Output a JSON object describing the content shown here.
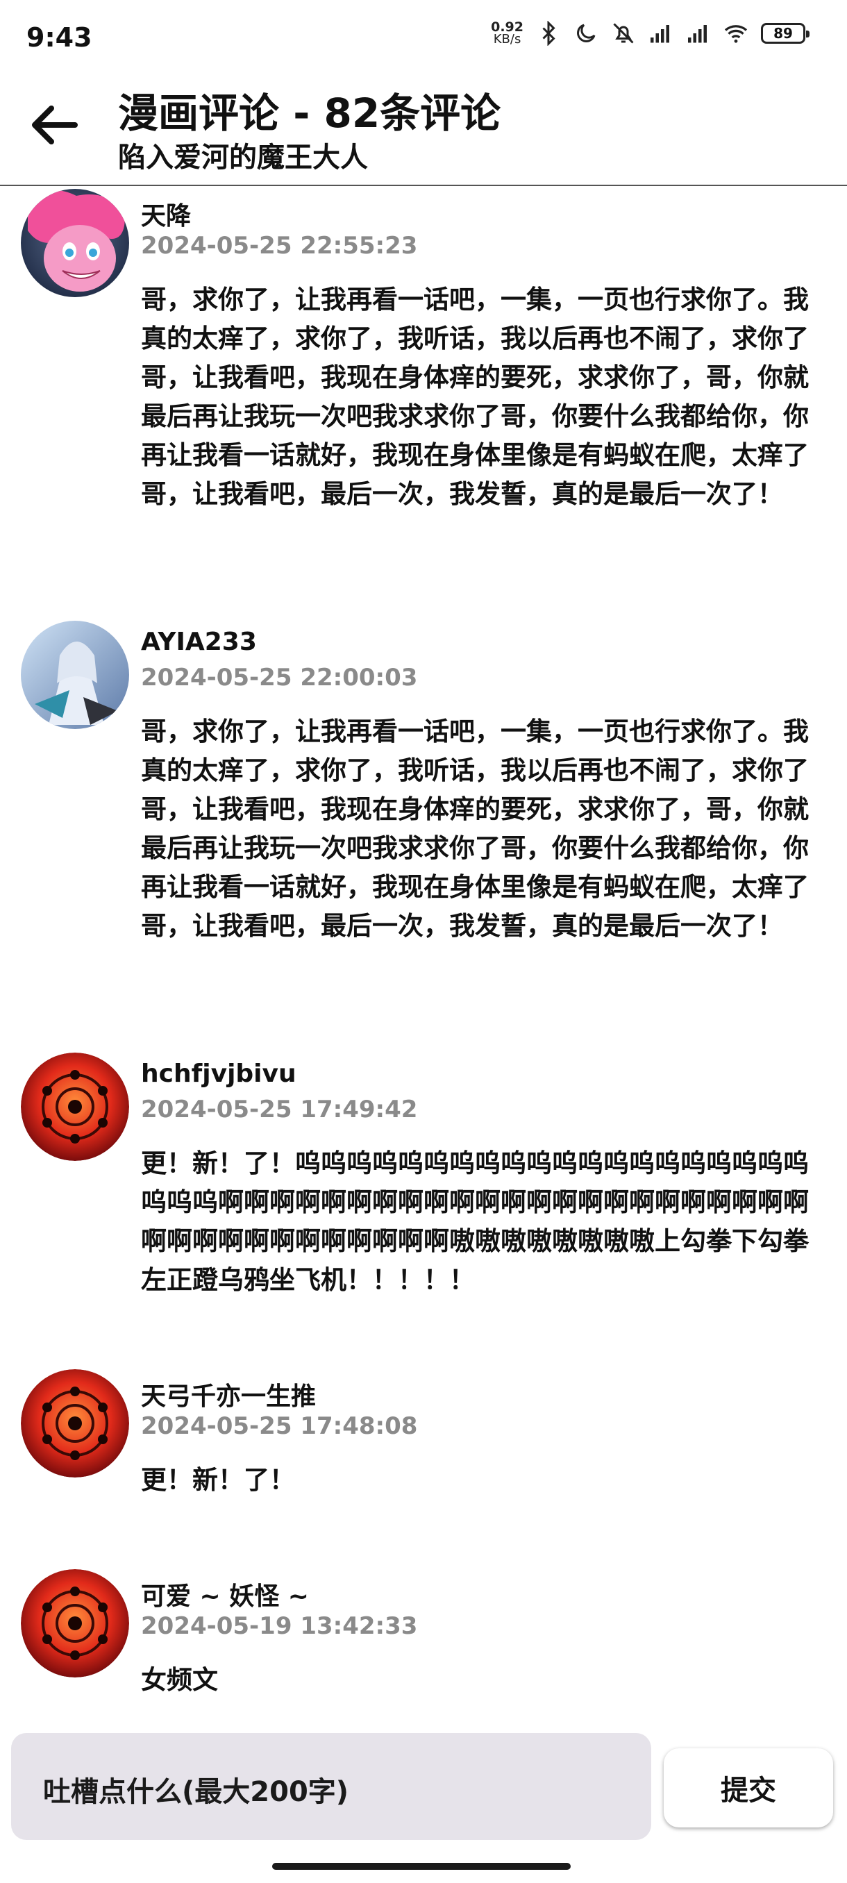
{
  "status_bar": {
    "time": "9:43",
    "net_speed_value": "0.92",
    "net_speed_unit": "KB/s",
    "battery": "89"
  },
  "header": {
    "title": "漫画评论 - 82条评论",
    "subtitle": "陷入爱河的魔王大人"
  },
  "comments": [
    {
      "user": "天降",
      "date": "2024-05-25 22:55:23",
      "text": "哥，求你了，让我再看一话吧，一集，一页也行求你了。我真的太痒了，求你了，我听话，我以后再也不闹了，求你了哥，让我看吧，我现在身体痒的要死，求求你了，哥，你就最后再让我玩一次吧我求求你了哥，你要什么我都给你，你再让我看一话就好，我现在身体里像是有蚂蚁在爬，太痒了 哥，让我看吧，最后一次，我发誓，真的是最后一次了！"
    },
    {
      "user": "AYIA233",
      "date": "2024-05-25 22:00:03",
      "text": "哥，求你了，让我再看一话吧，一集，一页也行求你了。我真的太痒了，求你了，我听话，我以后再也不闹了，求你了哥，让我看吧，我现在身体痒的要死，求求你了，哥，你就最后再让我玩一次吧我求求你了哥，你要什么我都给你，你再让我看一话就好，我现在身体里像是有蚂蚁在爬，太痒了 哥，让我看吧，最后一次，我发誓，真的是最后一次了！"
    },
    {
      "user": "hchfjvjbivu",
      "date": "2024-05-25 17:49:42",
      "text": "更！新！了！呜呜呜呜呜呜呜呜呜呜呜呜呜呜呜呜呜呜呜呜呜呜呜啊啊啊啊啊啊啊啊啊啊啊啊啊啊啊啊啊啊啊啊啊啊啊啊啊啊啊啊啊啊啊啊啊啊啊嗷嗷嗷嗷嗷嗷嗷嗷上勾拳下勾拳左正蹬乌鸦坐飞机！！！！！"
    },
    {
      "user": "天弓千亦一生推",
      "date": "2024-05-25 17:48:08",
      "text": "更！新！了！"
    },
    {
      "user": "可爱 ~ 妖怪 ~",
      "date": "2024-05-19 13:42:33",
      "text": "女频文"
    }
  ],
  "input": {
    "placeholder": "吐槽点什么(最大200字)",
    "submit_label": "提交"
  }
}
